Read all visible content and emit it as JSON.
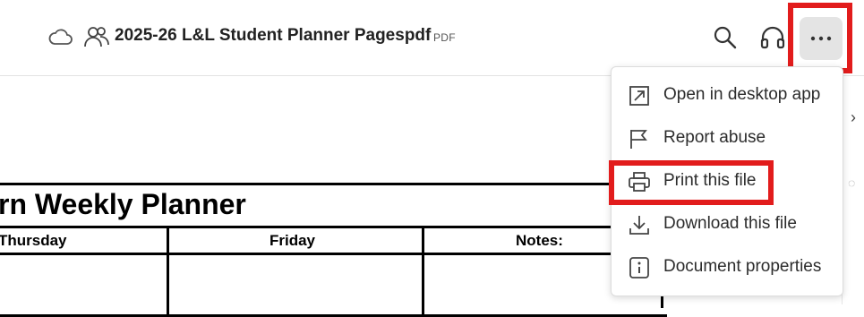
{
  "header": {
    "document_title": "2025-26 L&L Student Planner Pagespdf",
    "file_type": "PDF",
    "icons": [
      "cloud-icon",
      "shared-users-icon",
      "search-icon",
      "headphones-icon",
      "more-options-icon"
    ]
  },
  "more_menu": {
    "items": [
      {
        "label": "Open in desktop app",
        "icon": "open-external-icon"
      },
      {
        "label": "Report abuse",
        "icon": "flag-icon"
      },
      {
        "label": "Print this file",
        "icon": "printer-icon"
      },
      {
        "label": "Download this file",
        "icon": "download-icon"
      },
      {
        "label": "Document properties",
        "icon": "info-icon"
      }
    ]
  },
  "document": {
    "planner_title": "rn Weekly Planner",
    "columns": [
      "Thursday",
      "Friday",
      "Notes:"
    ]
  },
  "highlights": {
    "color": "#e21c1c"
  }
}
